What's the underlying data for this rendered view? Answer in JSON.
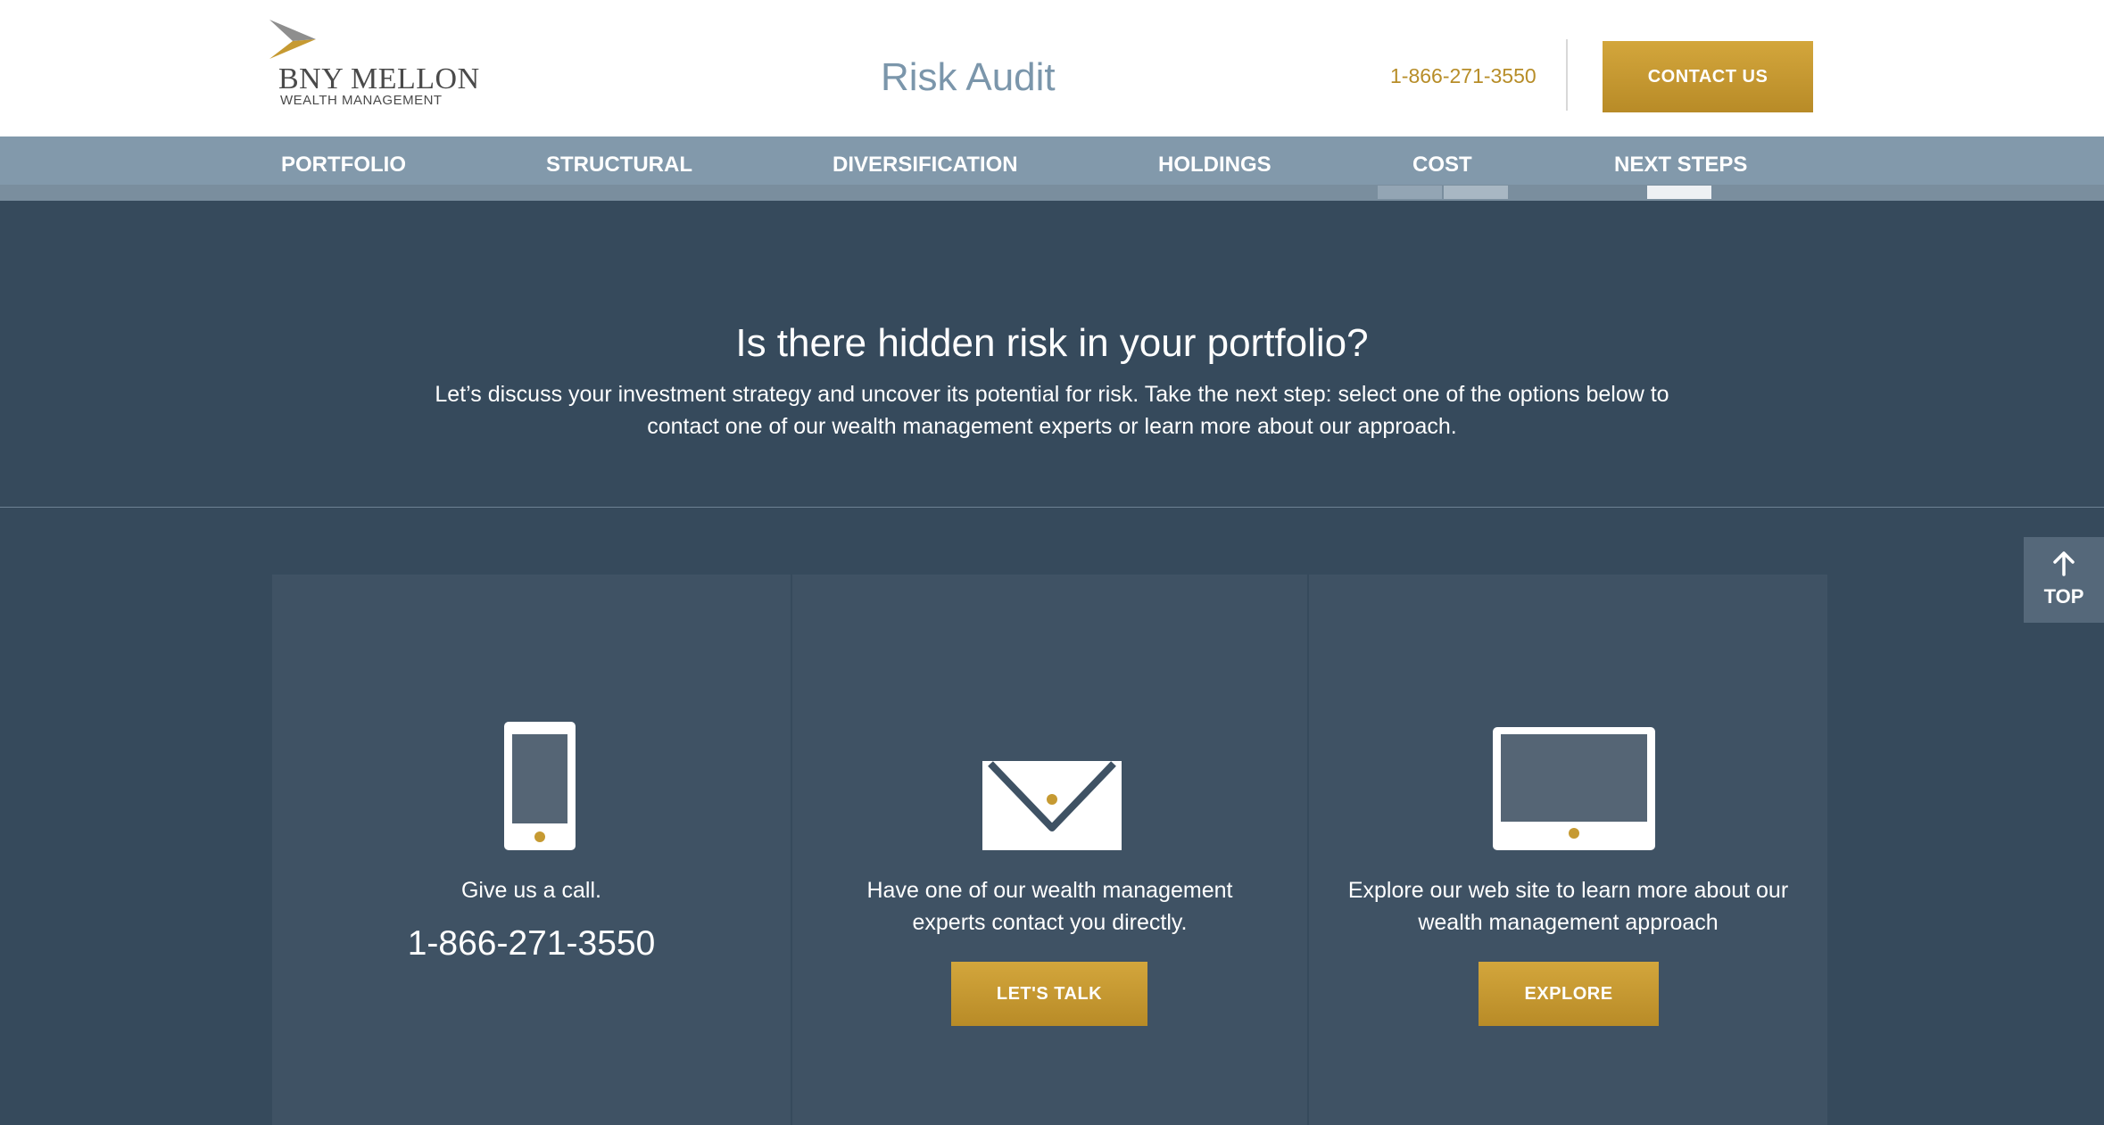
{
  "header": {
    "logo_main": "BNY MELLON",
    "logo_sub": "WEALTH MANAGEMENT",
    "title": "Risk Audit",
    "phone": "1-866-271-3550",
    "contact_label": "CONTACT US"
  },
  "nav": {
    "items": [
      {
        "label": "PORTFOLIO"
      },
      {
        "label": "STRUCTURAL"
      },
      {
        "label": "DIVERSIFICATION"
      },
      {
        "label": "HOLDINGS"
      },
      {
        "label": "COST"
      },
      {
        "label": "NEXT STEPS"
      }
    ]
  },
  "hero": {
    "title": "Is there hidden risk in your portfolio?",
    "text": "Let’s discuss your investment strategy and uncover its potential for risk. Take the next step: select one of the options below to contact one of our wealth management experts or learn more about our approach."
  },
  "top_button": {
    "arrow": "🡑",
    "label": "TOP"
  },
  "cards": [
    {
      "icon": "phone-icon",
      "text": "Give us a call.",
      "phone": "1-866-271-3550"
    },
    {
      "icon": "envelope-icon",
      "text": "Have one of our wealth management experts contact you directly.",
      "button": "LET'S TALK"
    },
    {
      "icon": "tablet-icon",
      "text": "Explore our web site to learn more about our wealth management approach",
      "button": "EXPLORE"
    }
  ],
  "colors": {
    "gold": "#c69a32",
    "navy_bg": "#364a5c",
    "card_bg": "#3f5264",
    "nav_bg": "#8299ab",
    "title_blue": "#7b96ab"
  }
}
